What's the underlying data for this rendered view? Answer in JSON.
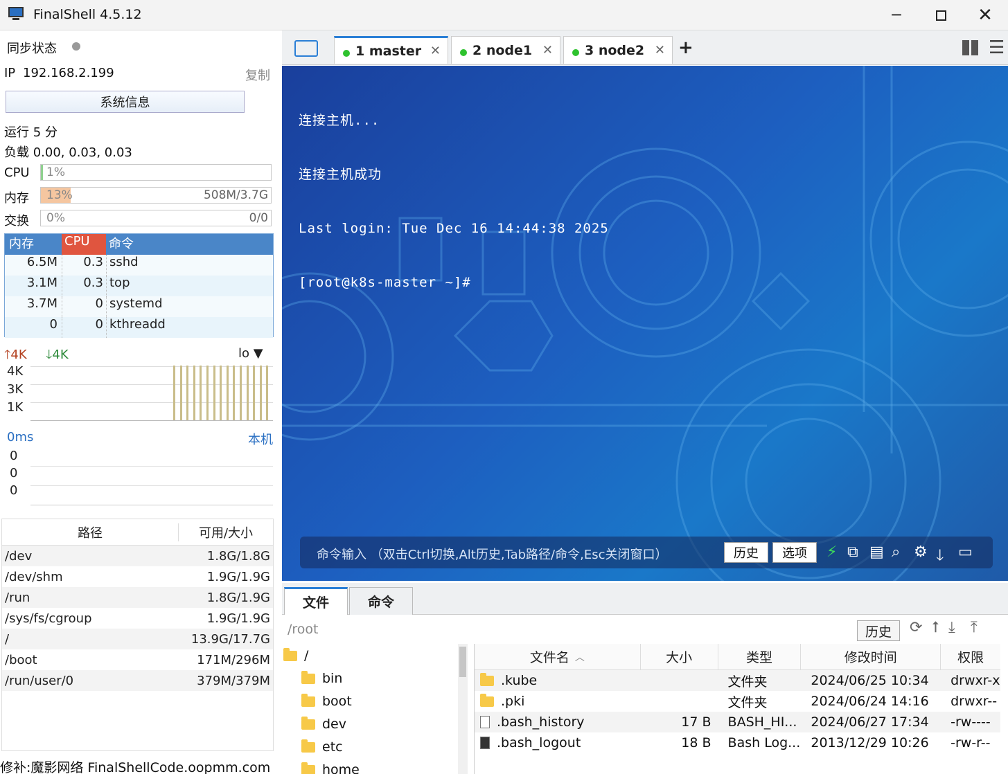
{
  "window": {
    "title": "FinalShell 4.5.12"
  },
  "left": {
    "sync_label": "同步状态",
    "ip_label": "IP",
    "ip": "192.168.2.199",
    "copy": "复制",
    "sysinfo_button": "系统信息",
    "uptime": "运行 5 分",
    "load": "负载 0.00, 0.03, 0.03",
    "cpu": {
      "label": "CPU",
      "pct": "1%",
      "level": 0.01
    },
    "mem": {
      "label": "内存",
      "pct": "13%",
      "amount": "508M/3.7G",
      "level": 0.13
    },
    "swap": {
      "label": "交换",
      "pct": "0%",
      "amount": "0/0",
      "level": 0
    },
    "process_table": {
      "headers": [
        "内存",
        "CPU",
        "命令"
      ],
      "rows": [
        {
          "mem": "6.5M",
          "cpu": "0.3",
          "cmd": "sshd"
        },
        {
          "mem": "3.1M",
          "cpu": "0.3",
          "cmd": "top"
        },
        {
          "mem": "3.7M",
          "cpu": "0",
          "cmd": "systemd"
        },
        {
          "mem": "0",
          "cpu": "0",
          "cmd": "kthreadd"
        }
      ]
    },
    "net": {
      "up": "4K",
      "down": "4K",
      "iface": "lo",
      "ticks": [
        "4K",
        "3K",
        "1K"
      ]
    },
    "ping": {
      "latency": "0ms",
      "target": "本机",
      "ticks": [
        "0",
        "0",
        "0"
      ]
    },
    "disk_table": {
      "headers": [
        "路径",
        "可用/大小"
      ],
      "rows": [
        {
          "path": "/dev",
          "size": "1.8G/1.8G"
        },
        {
          "path": "/dev/shm",
          "size": "1.9G/1.9G"
        },
        {
          "path": "/run",
          "size": "1.8G/1.9G"
        },
        {
          "path": "/sys/fs/cgroup",
          "size": "1.9G/1.9G"
        },
        {
          "path": "/",
          "size": "13.9G/17.7G"
        },
        {
          "path": "/boot",
          "size": "171M/296M"
        },
        {
          "path": "/run/user/0",
          "size": "379M/379M"
        }
      ]
    },
    "footer": "修补:魔影网络 FinalShellCode.oopmm.com"
  },
  "tabs": [
    {
      "label": "1 master"
    },
    {
      "label": "2 node1"
    },
    {
      "label": "3 node2"
    }
  ],
  "terminal": {
    "lines": [
      "连接主机...",
      "连接主机成功",
      "Last login: Tue Dec 16 14:44:38 2025",
      "[root@k8s-master ~]#"
    ],
    "cmd_placeholder": "命令输入 （双击Ctrl切换,Alt历史,Tab路径/命令,Esc关闭窗口）",
    "history_button": "历史",
    "options_button": "选项"
  },
  "bottom": {
    "tabs": [
      "文件",
      "命令"
    ],
    "path": "/root",
    "history_button": "历史",
    "tree": [
      "/",
      "bin",
      "boot",
      "dev",
      "etc",
      "home"
    ],
    "file_headers": [
      "文件名",
      "大小",
      "类型",
      "修改时间",
      "权限"
    ],
    "files": [
      {
        "name": ".kube",
        "size": "",
        "type": "文件夹",
        "time": "2024/06/25 10:34",
        "perm": "drwxr-x",
        "icon": "folder"
      },
      {
        "name": ".pki",
        "size": "",
        "type": "文件夹",
        "time": "2024/06/24 14:16",
        "perm": "drwxr--",
        "icon": "folder"
      },
      {
        "name": ".bash_history",
        "size": "17 B",
        "type": "BASH_HI...",
        "time": "2024/06/27 17:34",
        "perm": "-rw----",
        "icon": "file"
      },
      {
        "name": ".bash_logout",
        "size": "18 B",
        "type": "Bash Log...",
        "time": "2013/12/29 10:26",
        "perm": "-rw-r--",
        "icon": "file-dark"
      }
    ]
  }
}
